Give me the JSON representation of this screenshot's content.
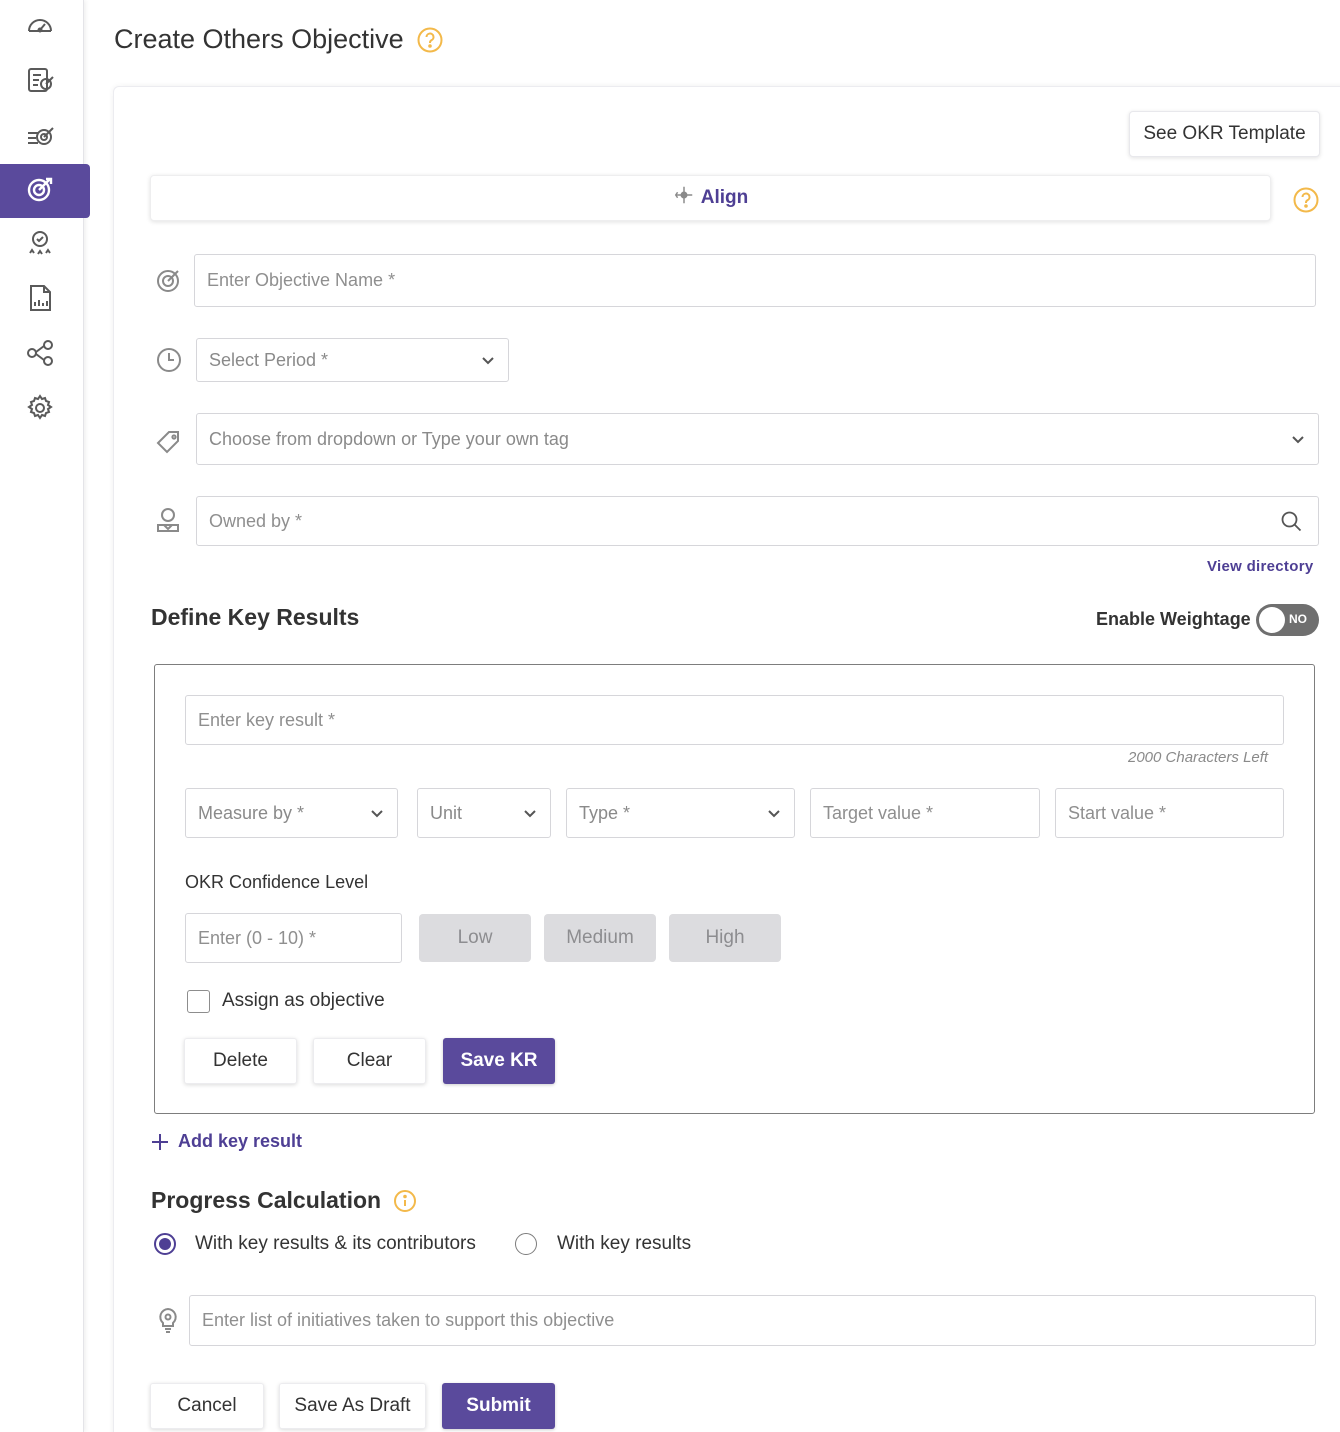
{
  "sidebar": {
    "items": [
      {
        "icon": "dashboard-icon",
        "active": false
      },
      {
        "icon": "my-okr-icon",
        "active": false
      },
      {
        "icon": "team-okr-icon",
        "active": false
      },
      {
        "icon": "create-objective-icon",
        "active": true
      },
      {
        "icon": "reviews-icon",
        "active": false
      },
      {
        "icon": "reports-icon",
        "active": false
      },
      {
        "icon": "alignment-map-icon",
        "active": false
      },
      {
        "icon": "settings-icon",
        "active": false
      }
    ]
  },
  "page": {
    "title": "Create Others Objective"
  },
  "toolbar": {
    "see_template_label": "See OKR Template",
    "align_label": "Align"
  },
  "objective": {
    "name_placeholder": "Enter Objective Name *",
    "period_placeholder": "Select Period *",
    "tag_placeholder": "Choose from dropdown or Type your own tag",
    "owner_placeholder": "Owned by *",
    "view_directory_label": "View directory"
  },
  "key_results": {
    "section_title": "Define Key Results",
    "weightage_label": "Enable Weightage",
    "weightage_toggle": "NO",
    "kr_placeholder": "Enter key result *",
    "chars_left": "2000 Characters Left",
    "measure_by_placeholder": "Measure by *",
    "unit_placeholder": "Unit",
    "type_placeholder": "Type *",
    "target_placeholder": "Target value *",
    "start_placeholder": "Start value *",
    "confidence_label": "OKR Confidence Level",
    "confidence_placeholder": "Enter (0 - 10) *",
    "confidence_levels": [
      "Low",
      "Medium",
      "High"
    ],
    "assign_label": "Assign as objective",
    "delete_label": "Delete",
    "clear_label": "Clear",
    "save_label": "Save KR",
    "add_label": "Add key result"
  },
  "progress": {
    "section_title": "Progress Calculation",
    "options": [
      "With key results & its contributors",
      "With key results"
    ],
    "selected": 0,
    "initiatives_placeholder": "Enter list of initiatives taken to support this objective"
  },
  "footer": {
    "cancel_label": "Cancel",
    "draft_label": "Save As Draft",
    "submit_label": "Submit"
  },
  "colors": {
    "primary": "#5a4a9c",
    "link": "#4e3f94",
    "help": "#f3b94a"
  }
}
